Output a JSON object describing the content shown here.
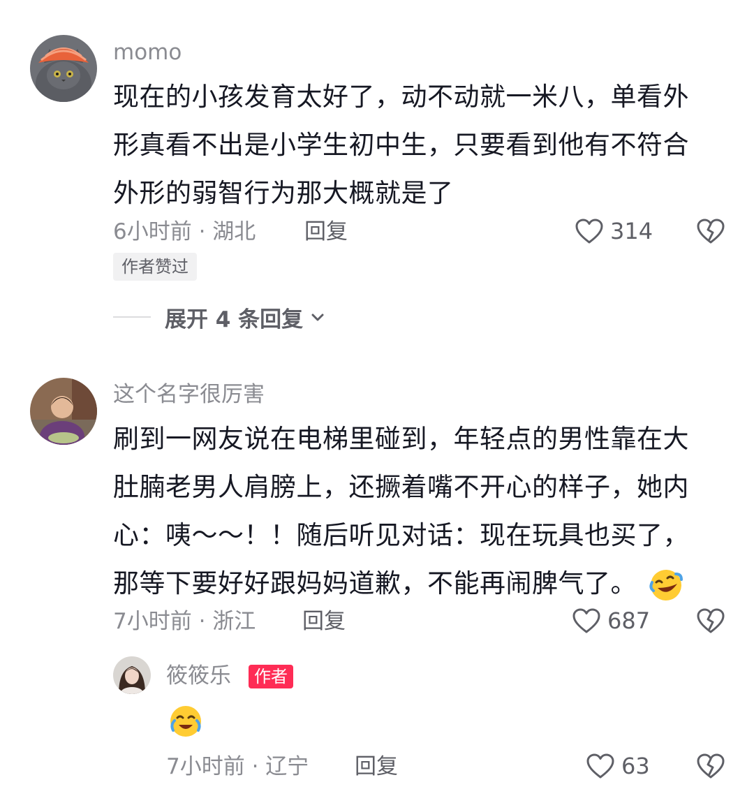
{
  "comments": [
    {
      "username": "momo",
      "text_lines": [
        "现在的小孩发育太好了，动不动就一米八，单看外",
        "形真看不出是小学生初中生，只要看到他有不符合",
        "外形的弱智行为那大概就是了"
      ],
      "meta": "6小时前 · 湖北",
      "reply_label": "回复",
      "likes": "314",
      "badge": "作者赞过",
      "expand_label": "展开 4 条回复"
    },
    {
      "username": "这个名字很厉害",
      "text_lines": [
        "刷到一网友说在电梯里碰到，年轻点的男性靠在大",
        "肚腩老男人肩膀上，还撅着嘴不开心的样子，她内",
        "心：咦～～！！随后听见对话：现在玩具也买了，",
        "那等下要好好跟妈妈道歉，不能再闹脾气了。"
      ],
      "meta": "7小时前 · 浙江",
      "reply_label": "回复",
      "likes": "687",
      "reply": {
        "username": "筱筱乐",
        "author_tag": "作者",
        "meta": "7小时前 · 辽宁",
        "reply_label": "回复",
        "likes": "63"
      }
    }
  ],
  "icons": {
    "like": "heart-outline-icon",
    "dislike": "broken-heart-icon",
    "expand": "chevron-down-icon",
    "emoji": "laughing-crying-emoji"
  },
  "colors": {
    "text": "#161823",
    "secondary": "#8a8b91",
    "action": "#5e5f66",
    "author_tag": "#fe2c55"
  }
}
